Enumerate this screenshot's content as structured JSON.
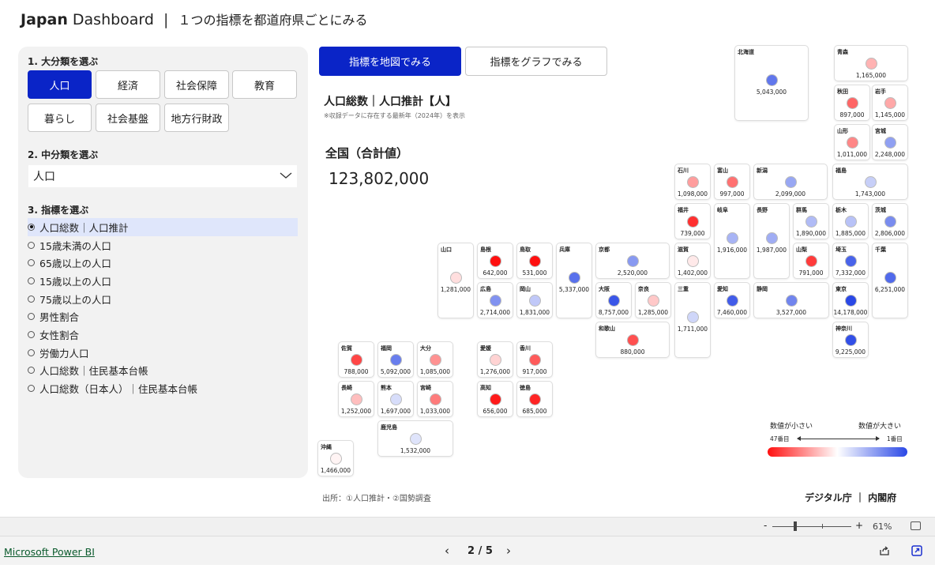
{
  "header": {
    "brand_bold": "Japan",
    "brand_rest": "Dashboard",
    "separator": "|",
    "subtitle": "１つの指標を都道府県ごとにみる"
  },
  "filters": {
    "section1_label": "1. 大分類を選ぶ",
    "categories": [
      {
        "label": "人口",
        "active": true
      },
      {
        "label": "経済",
        "active": false
      },
      {
        "label": "社会保障",
        "active": false
      },
      {
        "label": "教育",
        "active": false
      },
      {
        "label": "暮らし",
        "active": false
      },
      {
        "label": "社会基盤",
        "active": false
      },
      {
        "label": "地方行財政",
        "active": false
      }
    ],
    "section2_label": "2. 中分類を選ぶ",
    "subcategory_value": "人口",
    "section3_label": "3. 指標を選ぶ",
    "indicators": [
      {
        "label": "人口総数｜人口推計",
        "selected": true
      },
      {
        "label": "15歳未満の人口",
        "selected": false
      },
      {
        "label": "65歳以上の人口",
        "selected": false
      },
      {
        "label": "15歳以上の人口",
        "selected": false
      },
      {
        "label": "75歳以上の人口",
        "selected": false
      },
      {
        "label": "男性割合",
        "selected": false
      },
      {
        "label": "女性割合",
        "selected": false
      },
      {
        "label": "労働力人口",
        "selected": false
      },
      {
        "label": "人口総数｜住民基本台帳",
        "selected": false
      },
      {
        "label": "人口総数（日本人）｜住民基本台帳",
        "selected": false
      }
    ]
  },
  "tabs": {
    "map_label": "指標を地図でみる",
    "graph_label": "指標をグラフでみる"
  },
  "indicator": {
    "title": "人口総数｜人口推計【人】",
    "note": "※収録データに存在する最新年（2024年）を表示",
    "total_label": "全国（合計値）",
    "total_value": "123,802,000"
  },
  "colors": {
    "low": "#ff1010",
    "mid": "#ffffff",
    "high": "#2a48e6",
    "accent": "#0a24c7"
  },
  "prefectures": [
    {
      "name": "北海道",
      "value": "5,043,000",
      "rank": 8
    },
    {
      "name": "青森",
      "value": "1,165,000",
      "rank": 31
    },
    {
      "name": "秋田",
      "value": "897,000",
      "rank": 38
    },
    {
      "name": "岩手",
      "value": "1,145,000",
      "rank": 32
    },
    {
      "name": "山形",
      "value": "1,011,000",
      "rank": 35
    },
    {
      "name": "宮城",
      "value": "2,248,000",
      "rank": 14
    },
    {
      "name": "石川",
      "value": "1,098,000",
      "rank": 33
    },
    {
      "name": "富山",
      "value": "997,000",
      "rank": 37
    },
    {
      "name": "新潟",
      "value": "2,099,000",
      "rank": 15
    },
    {
      "name": "福島",
      "value": "1,743,000",
      "rank": 21
    },
    {
      "name": "福井",
      "value": "739,000",
      "rank": 43
    },
    {
      "name": "岐阜",
      "value": "1,916,000",
      "rank": 17
    },
    {
      "name": "長野",
      "value": "1,987,000",
      "rank": 16
    },
    {
      "name": "群馬",
      "value": "1,890,000",
      "rank": 18
    },
    {
      "name": "栃木",
      "value": "1,885,000",
      "rank": 19
    },
    {
      "name": "茨城",
      "value": "2,806,000",
      "rank": 11
    },
    {
      "name": "山口",
      "value": "1,281,000",
      "rank": 27
    },
    {
      "name": "島根",
      "value": "642,000",
      "rank": 46
    },
    {
      "name": "鳥取",
      "value": "531,000",
      "rank": 47
    },
    {
      "name": "兵庫",
      "value": "5,337,000",
      "rank": 7
    },
    {
      "name": "京都",
      "value": "2,520,000",
      "rank": 13
    },
    {
      "name": "滋賀",
      "value": "1,402,000",
      "rank": 26
    },
    {
      "name": "山梨",
      "value": "791,000",
      "rank": 42
    },
    {
      "name": "埼玉",
      "value": "7,332,000",
      "rank": 5
    },
    {
      "name": "千葉",
      "value": "6,251,000",
      "rank": 6
    },
    {
      "name": "広島",
      "value": "2,714,000",
      "rank": 12
    },
    {
      "name": "岡山",
      "value": "1,831,000",
      "rank": 20
    },
    {
      "name": "大阪",
      "value": "8,757,000",
      "rank": 3
    },
    {
      "name": "奈良",
      "value": "1,285,000",
      "rank": 29
    },
    {
      "name": "三重",
      "value": "1,711,000",
      "rank": 22
    },
    {
      "name": "愛知",
      "value": "7,460,000",
      "rank": 4
    },
    {
      "name": "静岡",
      "value": "3,527,000",
      "rank": 10
    },
    {
      "name": "東京",
      "value": "14,178,000",
      "rank": 1
    },
    {
      "name": "和歌山",
      "value": "880,000",
      "rank": 40
    },
    {
      "name": "神奈川",
      "value": "9,225,000",
      "rank": 2
    },
    {
      "name": "佐賀",
      "value": "788,000",
      "rank": 41
    },
    {
      "name": "福岡",
      "value": "5,092,000",
      "rank": 9
    },
    {
      "name": "大分",
      "value": "1,085,000",
      "rank": 34
    },
    {
      "name": "愛媛",
      "value": "1,276,000",
      "rank": 28
    },
    {
      "name": "香川",
      "value": "917,000",
      "rank": 39
    },
    {
      "name": "長崎",
      "value": "1,252,000",
      "rank": 30
    },
    {
      "name": "熊本",
      "value": "1,697,000",
      "rank": 23
    },
    {
      "name": "宮崎",
      "value": "1,033,000",
      "rank": 36
    },
    {
      "name": "高知",
      "value": "656,000",
      "rank": 45
    },
    {
      "name": "徳島",
      "value": "685,000",
      "rank": 44
    },
    {
      "name": "鹿児島",
      "value": "1,532,000",
      "rank": 24
    },
    {
      "name": "沖縄",
      "value": "1,466,000",
      "rank": 25
    }
  ],
  "legend": {
    "small_label": "数値が小さい",
    "large_label": "数値が大きい",
    "rank_low": "47番目",
    "rank_high": "1番目"
  },
  "source": "出所：①人口推計・②国勢調査",
  "credit": "デジタル庁 ｜ 内閣府",
  "zoom": {
    "minus": "-",
    "plus": "+",
    "level": "61%",
    "percent": 61
  },
  "footer": {
    "link": "Microsoft Power BI",
    "page": "2 / 5",
    "prev": "‹",
    "next": "›"
  }
}
